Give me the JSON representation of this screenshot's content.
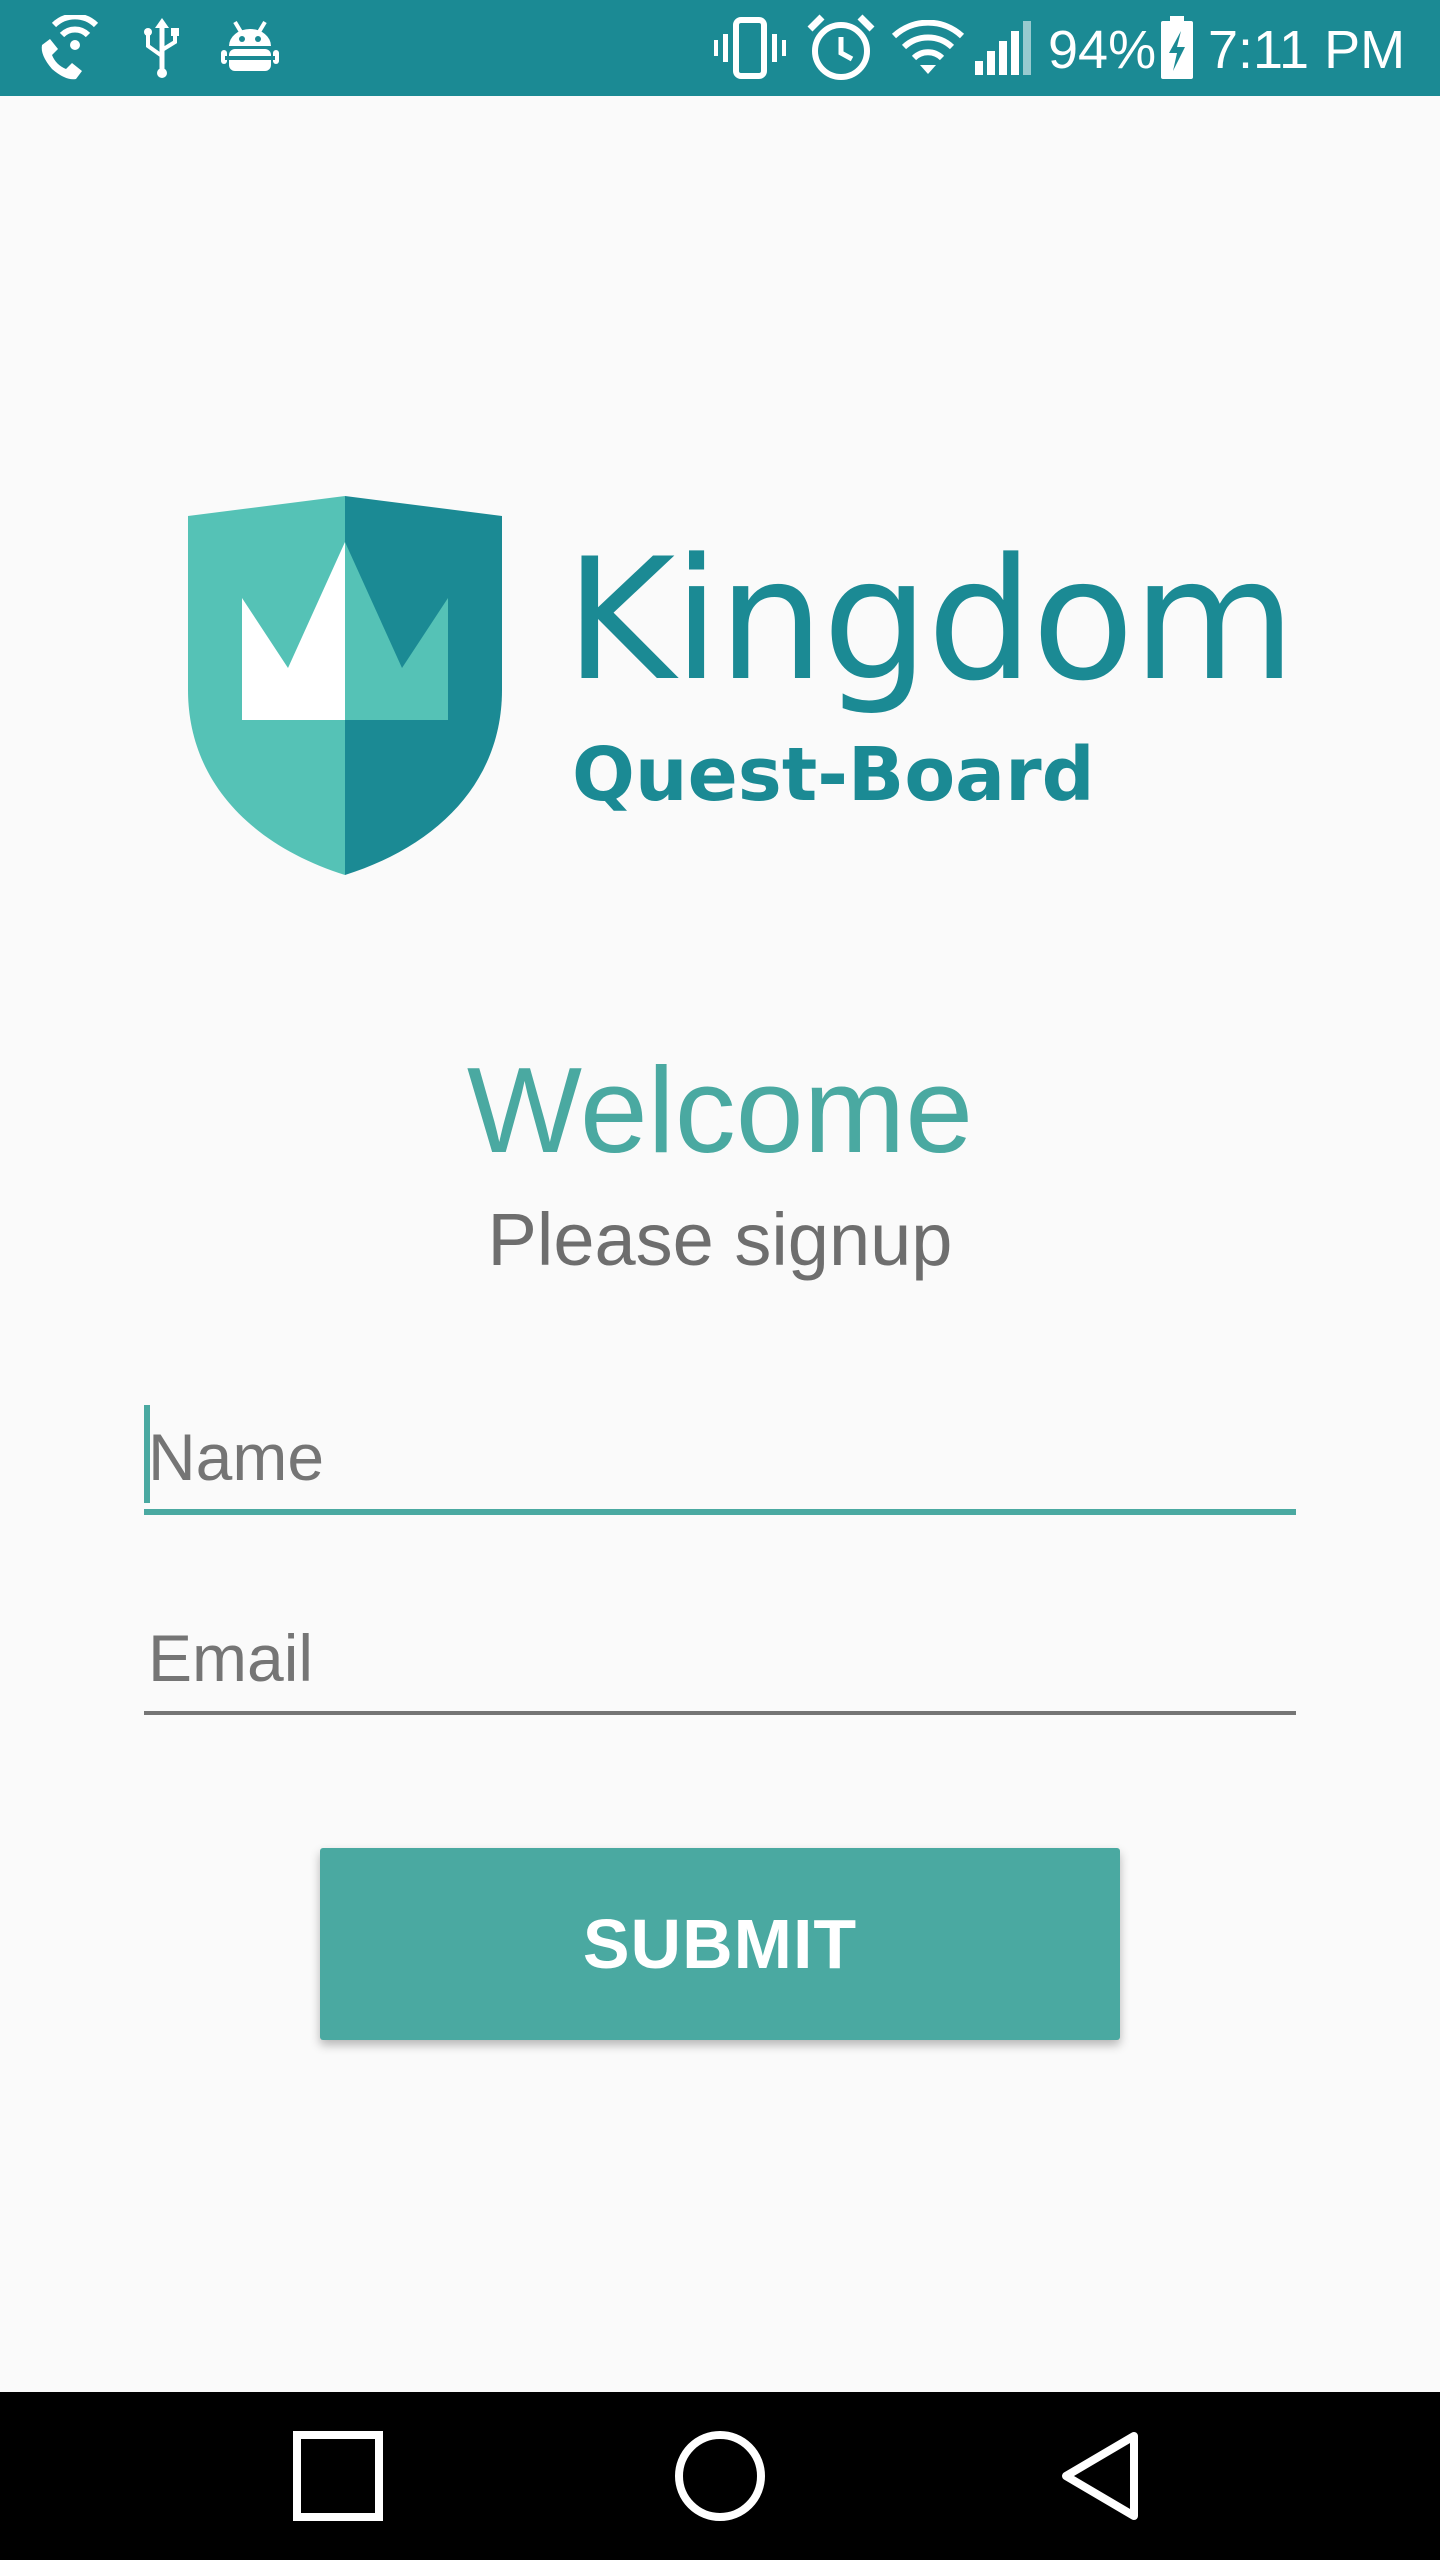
{
  "status_bar": {
    "icons_left": [
      "wifi-calling-icon",
      "usb-icon",
      "android-debug-icon"
    ],
    "icons_right": [
      "vibrate-icon",
      "alarm-icon",
      "wifi-icon",
      "signal-icon",
      "battery-charging-icon"
    ],
    "battery": "94%",
    "time": "7:11 PM",
    "background_color": "#1b8a94"
  },
  "logo": {
    "title": "Kingdom",
    "subtitle": "Quest-Board",
    "color": "#1b8a94",
    "shield_colors": {
      "light": "#55c2b6",
      "dark": "#1b8a94",
      "crown": "#ffffff"
    }
  },
  "heading": {
    "title": "Welcome",
    "subtitle": "Please signup"
  },
  "form": {
    "name": {
      "value": "",
      "placeholder": "Name"
    },
    "email": {
      "value": "",
      "placeholder": "Email"
    },
    "submit_label": "SUBMIT"
  },
  "navigation": {
    "buttons": [
      "recent-apps-icon",
      "home-icon",
      "back-icon"
    ]
  },
  "colors": {
    "accent": "#4aa9a1",
    "primary_dark": "#1b8a94",
    "text_secondary": "#6e6e6e",
    "background": "#fafafa"
  }
}
